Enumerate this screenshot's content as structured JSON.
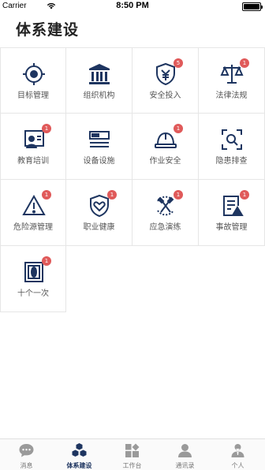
{
  "status_bar": {
    "carrier": "Carrier",
    "time": "8:50 PM"
  },
  "page_title": "体系建设",
  "colors": {
    "icon": "#1e3560",
    "badge": "#e05a5a",
    "tab_inactive": "#9a9a9a"
  },
  "grid": {
    "items": [
      {
        "label": "目标管理",
        "icon": "target-icon",
        "badge": ""
      },
      {
        "label": "组织机构",
        "icon": "building-icon",
        "badge": ""
      },
      {
        "label": "安全投入",
        "icon": "shield-yen-icon",
        "badge": "5"
      },
      {
        "label": "法律法规",
        "icon": "scales-icon",
        "badge": "1"
      },
      {
        "label": "教育培训",
        "icon": "training-icon",
        "badge": "1"
      },
      {
        "label": "设备设施",
        "icon": "equipment-icon",
        "badge": ""
      },
      {
        "label": "作业安全",
        "icon": "helmet-icon",
        "badge": "1"
      },
      {
        "label": "隐患排查",
        "icon": "scan-icon",
        "badge": ""
      },
      {
        "label": "危险源管理",
        "icon": "warning-icon",
        "badge": "1"
      },
      {
        "label": "职业健康",
        "icon": "shield-heart-icon",
        "badge": "1"
      },
      {
        "label": "应急演练",
        "icon": "emergency-icon",
        "badge": "1"
      },
      {
        "label": "事故管理",
        "icon": "accident-report-icon",
        "badge": "1"
      },
      {
        "label": "十个一次",
        "icon": "ten-once-icon",
        "badge": "1"
      }
    ]
  },
  "tabs": [
    {
      "label": "消息",
      "icon": "message-icon",
      "active": false
    },
    {
      "label": "体系建设",
      "icon": "cubes-icon",
      "active": true
    },
    {
      "label": "工作台",
      "icon": "dashboard-icon",
      "active": false
    },
    {
      "label": "通讯录",
      "icon": "contacts-icon",
      "active": false
    },
    {
      "label": "个人",
      "icon": "person-icon",
      "active": false
    }
  ]
}
